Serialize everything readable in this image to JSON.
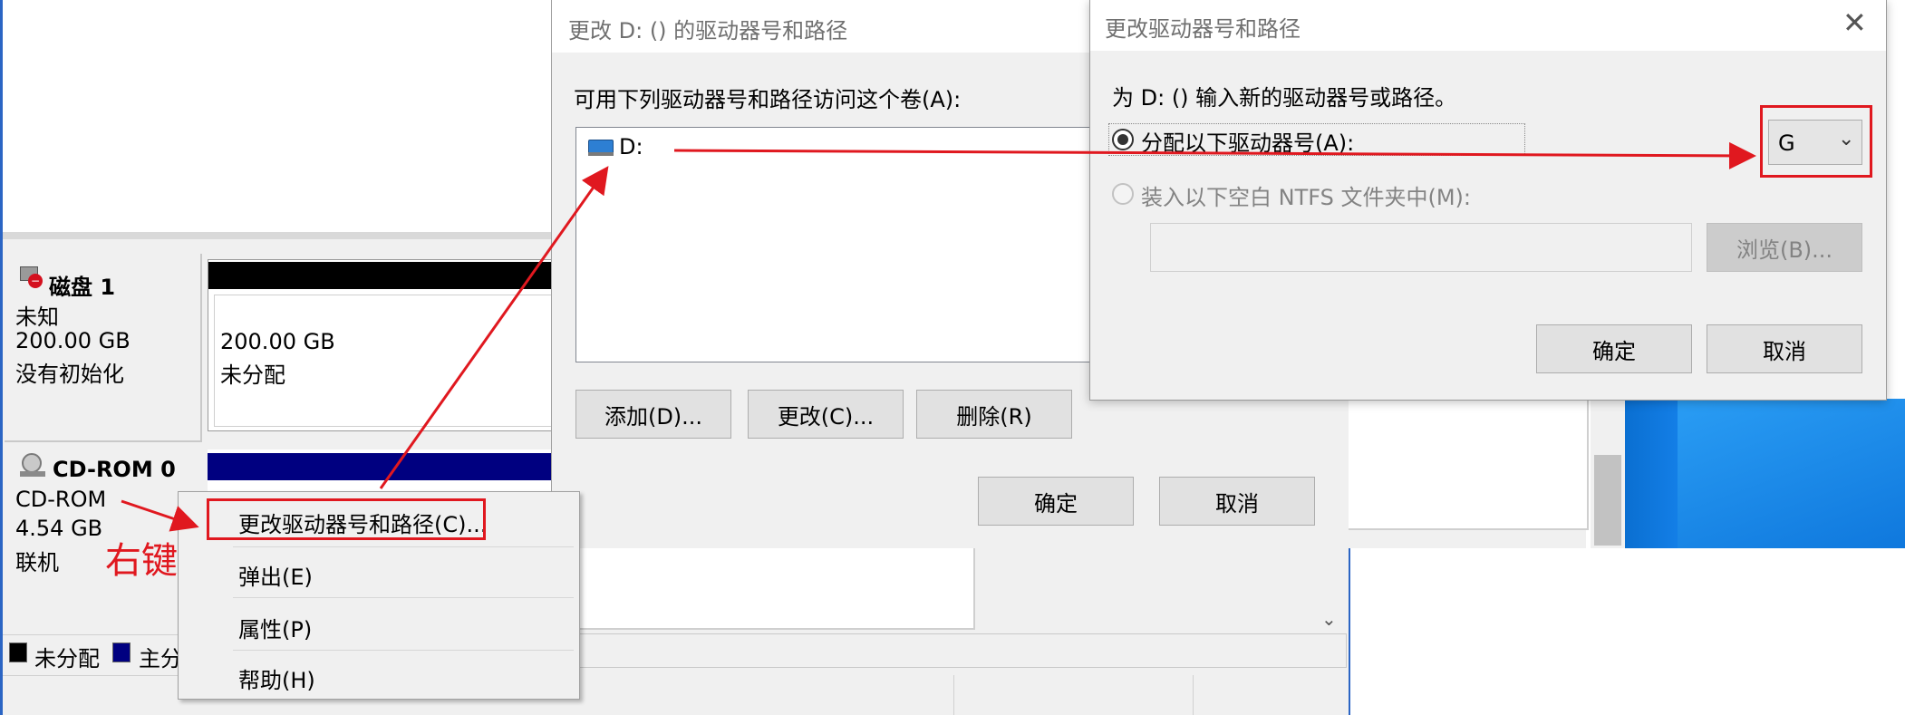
{
  "disk_mgmt": {
    "disk1": {
      "name": "磁盘 1",
      "type": "未知",
      "size": "200.00 GB",
      "status": "没有初始化",
      "partition_size": "200.00 GB",
      "partition_status": "未分配"
    },
    "cdrom": {
      "name": "CD-ROM 0",
      "type": "CD-ROM",
      "size": "4.54 GB",
      "status": "联机"
    },
    "legend": [
      {
        "label": "未分配",
        "color": "#000000"
      },
      {
        "label": "主分",
        "color": "#000080"
      }
    ]
  },
  "context_menu": {
    "items": [
      "更改驱动器号和路径(C)...",
      "弹出(E)",
      "属性(P)",
      "帮助(H)"
    ]
  },
  "annotation": {
    "right_click": "右键",
    "color": "#e0181f"
  },
  "dialog1": {
    "title": "更改 D: () 的驱动器号和路径",
    "prompt": "可用下列驱动器号和路径访问这个卷(A):",
    "list_items": [
      "D:"
    ],
    "buttons": {
      "add": "添加(D)...",
      "change": "更改(C)...",
      "delete": "删除(R)",
      "ok": "确定",
      "cancel": "取消"
    }
  },
  "dialog2": {
    "title": "更改驱动器号和路径",
    "prompt": "为 D: () 输入新的驱动器号或路径。",
    "radio_assign": "分配以下驱动器号(A):",
    "radio_mount": "装入以下空白 NTFS 文件夹中(M):",
    "drive_letter": "G",
    "path_value": "",
    "buttons": {
      "browse": "浏览(B)...",
      "ok": "确定",
      "cancel": "取消"
    }
  }
}
